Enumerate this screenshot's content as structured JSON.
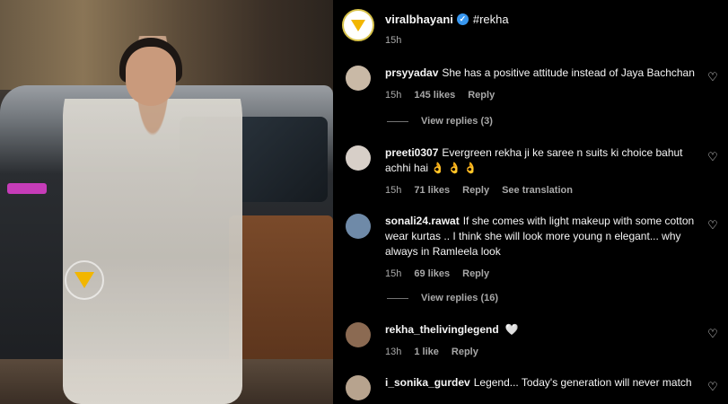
{
  "post": {
    "username": "viralbhayani",
    "caption": "#rekha",
    "time": "15h"
  },
  "comments": [
    {
      "username": "prsyyadav",
      "text": "She has a positive attitude instead of Jaya Bachchan",
      "time": "15h",
      "likes": "145 likes",
      "reply": "Reply",
      "view_replies": "View replies (3)",
      "avatar_color": "#c9b9a6"
    },
    {
      "username": "preeti0307",
      "text": "Evergreen rekha ji ke saree n suits ki choice bahut achhi hai 👌 👌 👌",
      "time": "15h",
      "likes": "71 likes",
      "reply": "Reply",
      "see_translation": "See translation",
      "avatar_color": "#d7cfc8"
    },
    {
      "username": "sonali24.rawat",
      "text": "If she comes with light makeup with some cotton wear kurtas .. I think she will look more young n elegant... why always in Ramleela look",
      "time": "15h",
      "likes": "69 likes",
      "reply": "Reply",
      "view_replies": "View replies (16)",
      "avatar_color": "#6f8aa8"
    },
    {
      "username": "rekha_thelivinglegend",
      "text": "🤍",
      "time": "13h",
      "likes": "1 like",
      "reply": "Reply",
      "avatar_color": "#8b6a52"
    },
    {
      "username": "i_sonika_gurdev",
      "text": "Legend... Today's generation will never match",
      "avatar_color": "#b7a38e"
    }
  ],
  "icons": {
    "like": "heart-outline-icon",
    "verified": "verified-badge-icon"
  },
  "colors": {
    "background": "#000000",
    "secondary_text": "#a8a8a8",
    "verified": "#3897f0",
    "brand": "#f2b600"
  }
}
